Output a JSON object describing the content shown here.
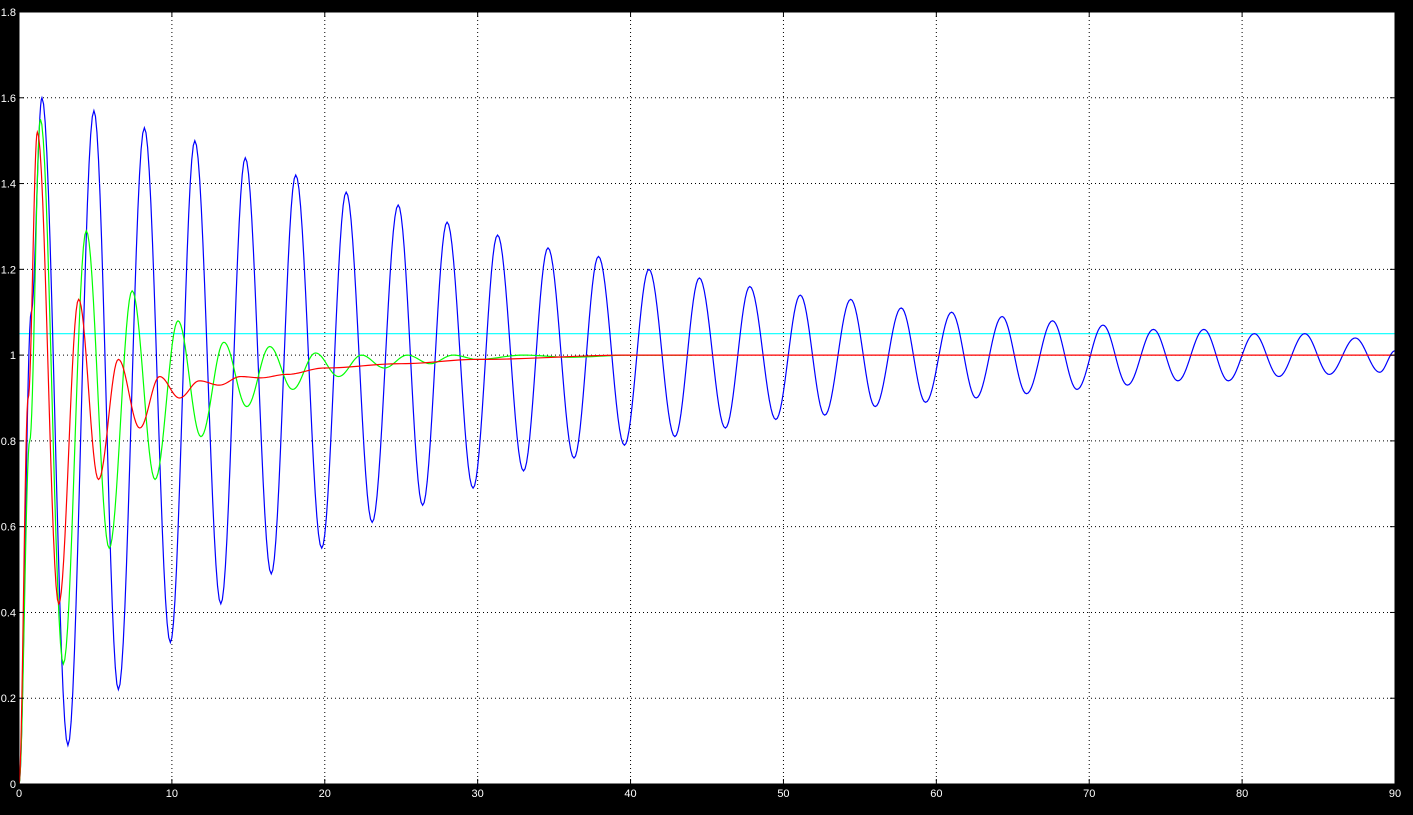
{
  "footer": "",
  "chart_data": {
    "type": "line",
    "title": "",
    "xlabel": "",
    "ylabel": "",
    "xlim": [
      0,
      90
    ],
    "ylim": [
      0,
      1.8
    ],
    "x_ticks": [
      0,
      10,
      20,
      30,
      40,
      50,
      60,
      70,
      80,
      90
    ],
    "y_ticks": [
      0,
      0.2,
      0.4,
      0.6,
      0.8,
      1,
      1.2,
      1.4,
      1.6,
      1.8
    ],
    "x_tick_labels": [
      "0",
      "10",
      "20",
      "30",
      "40",
      "50",
      "60",
      "70",
      "80",
      "90"
    ],
    "y_tick_labels": [
      "0",
      "0.2",
      "0.4",
      "0.6",
      "0.8",
      "1",
      "1.2",
      "1.4",
      "1.6",
      "1.8"
    ],
    "grid": true,
    "background": "#000000",
    "plot_background": "#ffffff",
    "series": [
      {
        "color": "#0000ff",
        "x": [
          0,
          0.8,
          1.5,
          3.2,
          4.9,
          6.5,
          8.2,
          9.9,
          11.5,
          13.2,
          14.8,
          16.5,
          18.1,
          19.8,
          21.4,
          23.1,
          24.8,
          26.4,
          28.0,
          29.7,
          31.3,
          33.0,
          34.6,
          36.3,
          37.9,
          39.6,
          41.2,
          42.9,
          44.5,
          46.2,
          47.8,
          49.5,
          51.1,
          52.7,
          54.4,
          56.0,
          57.7,
          59.3,
          61.0,
          62.6,
          64.3,
          65.9,
          67.6,
          69.2,
          70.9,
          72.5,
          74.2,
          75.8,
          77.5,
          79.1,
          80.8,
          82.4,
          84.1,
          85.7,
          87.4,
          89.0,
          90.0
        ],
        "y": [
          0,
          1.1,
          1.6,
          0.09,
          1.57,
          0.22,
          1.53,
          0.33,
          1.5,
          0.42,
          1.46,
          0.49,
          1.42,
          0.55,
          1.38,
          0.61,
          1.35,
          0.65,
          1.31,
          0.69,
          1.28,
          0.73,
          1.25,
          0.76,
          1.23,
          0.79,
          1.2,
          0.81,
          1.18,
          0.83,
          1.16,
          0.85,
          1.14,
          0.86,
          1.13,
          0.88,
          1.11,
          0.89,
          1.1,
          0.9,
          1.09,
          0.91,
          1.08,
          0.92,
          1.07,
          0.93,
          1.06,
          0.94,
          1.06,
          0.94,
          1.05,
          0.95,
          1.05,
          0.955,
          1.04,
          0.96,
          1.01
        ]
      },
      {
        "color": "#00ff00",
        "x": [
          0,
          0.7,
          1.4,
          2.9,
          4.4,
          5.9,
          7.4,
          8.9,
          10.4,
          11.9,
          13.4,
          14.9,
          16.4,
          17.9,
          19.4,
          20.9,
          22.4,
          23.9,
          25.4,
          26.9,
          28.4,
          30.0,
          33.0,
          36.0,
          40.0,
          44.0
        ],
        "y": [
          0,
          0.8,
          1.55,
          0.28,
          1.29,
          0.55,
          1.15,
          0.71,
          1.08,
          0.81,
          1.03,
          0.88,
          1.02,
          0.92,
          1.005,
          0.95,
          1.0,
          0.97,
          1.0,
          0.98,
          1.0,
          0.99,
          1.0,
          0.995,
          1.0,
          1.0
        ]
      },
      {
        "color": "#ff0000",
        "x": [
          0,
          0.6,
          1.2,
          2.6,
          3.9,
          5.2,
          6.5,
          7.9,
          9.2,
          10.5,
          11.8,
          13.1,
          14.5,
          15.8,
          17.5,
          20.0,
          25.0,
          30.0,
          40.0,
          50.0,
          60.0,
          70.0,
          80.0,
          90.0
        ],
        "y": [
          0,
          0.9,
          1.52,
          0.42,
          1.13,
          0.71,
          0.99,
          0.83,
          0.95,
          0.9,
          0.94,
          0.93,
          0.95,
          0.947,
          0.955,
          0.97,
          0.98,
          0.99,
          1.0,
          1.0,
          1.0,
          1.0,
          1.0,
          1.0
        ]
      },
      {
        "color": "#00ffff",
        "x": [
          0,
          90
        ],
        "y": [
          1.05,
          1.05
        ]
      }
    ]
  }
}
